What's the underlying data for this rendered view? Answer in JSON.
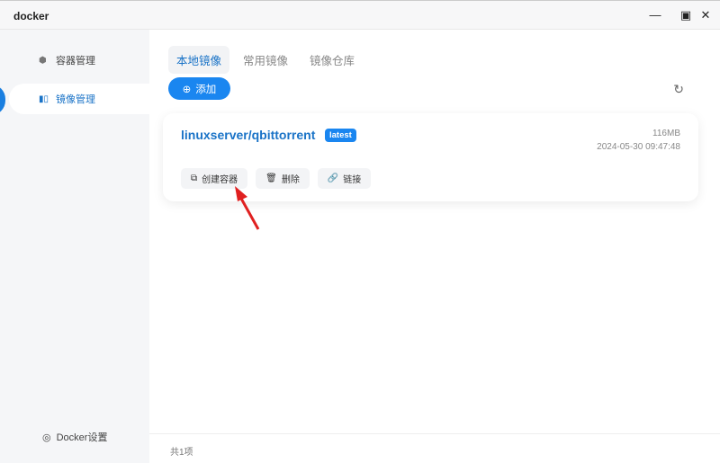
{
  "window": {
    "title": "docker",
    "minimize": "—",
    "maximize": "▣",
    "close": "✕"
  },
  "sidebar": {
    "items": [
      {
        "label": "容器管理",
        "icon": "hexagon-icon"
      },
      {
        "label": "镜像管理",
        "icon": "image-icon"
      }
    ],
    "settings": "Docker设置"
  },
  "tabs": [
    "本地镜像",
    "常用镜像",
    "镜像仓库"
  ],
  "add_label": "添加",
  "images": [
    {
      "name": "linuxserver/qbittorrent",
      "tag": "latest",
      "size": "116MB",
      "date": "2024-05-30 09:47:48",
      "actions": [
        "创建容器",
        "删除",
        "链接"
      ]
    }
  ],
  "footer": "共1项",
  "accent": "#1a86f0"
}
